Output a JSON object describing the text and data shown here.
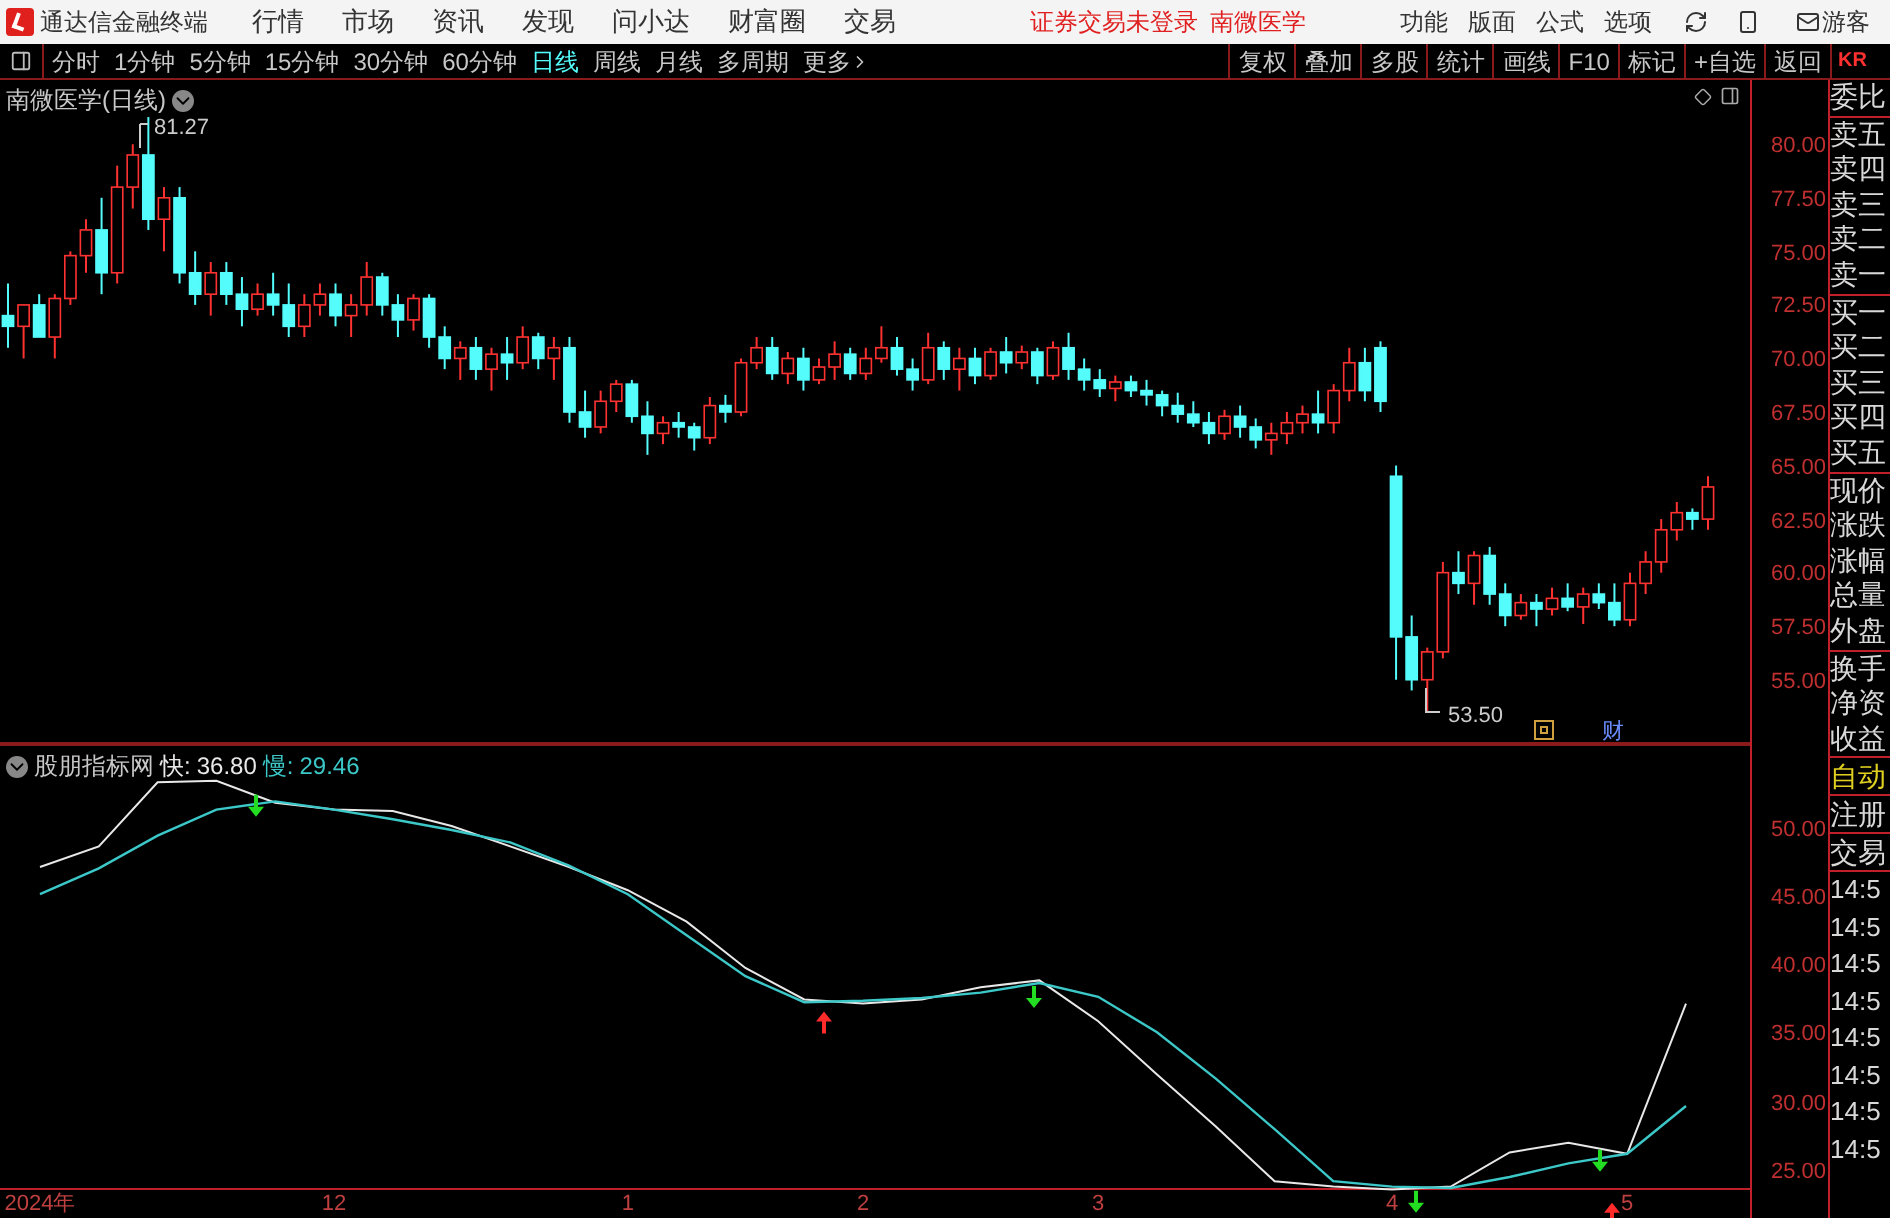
{
  "app": {
    "title": "通达信金融终端"
  },
  "menu": [
    "行情",
    "市场",
    "资讯",
    "发现",
    "问小达",
    "财富圈",
    "交易"
  ],
  "login_notice": "证券交易未登录",
  "stock_link": "南微医学",
  "menu_right": [
    "功能",
    "版面",
    "公式",
    "选项"
  ],
  "user": "游客",
  "periods": [
    {
      "label": "分时",
      "selected": false
    },
    {
      "label": "1分钟",
      "selected": false
    },
    {
      "label": "5分钟",
      "selected": false
    },
    {
      "label": "15分钟",
      "selected": false
    },
    {
      "label": "30分钟",
      "selected": false
    },
    {
      "label": "60分钟",
      "selected": false
    },
    {
      "label": "日线",
      "selected": true
    },
    {
      "label": "周线",
      "selected": false
    },
    {
      "label": "月线",
      "selected": false
    },
    {
      "label": "多周期",
      "selected": false
    },
    {
      "label": "更多",
      "selected": false
    }
  ],
  "tools": [
    "复权",
    "叠加",
    "多股",
    "统计",
    "画线",
    "F10",
    "标记",
    "+自选",
    "返回"
  ],
  "quote_tag": "KR",
  "price_chart": {
    "title": "南微医学(日线)",
    "high_label": "81.27",
    "low_label": "53.50",
    "finance_marker": "财",
    "chart_data": {
      "type": "candlestick",
      "ylim": [
        52,
        83
      ],
      "categories": [
        null,
        null,
        null,
        null,
        null,
        null,
        null,
        null,
        null,
        null,
        null,
        null,
        null,
        null,
        null,
        null,
        null,
        null,
        null,
        null,
        null,
        null,
        null,
        null,
        null,
        null,
        null,
        null,
        null,
        null,
        null,
        null,
        null,
        null,
        null,
        null,
        null,
        null,
        null,
        null,
        null,
        null,
        null,
        null,
        null,
        null,
        null,
        null,
        null,
        null,
        null,
        null,
        null,
        null,
        null,
        null,
        null,
        null,
        null,
        null,
        null,
        null,
        null,
        null,
        null,
        null,
        null,
        null,
        null,
        null,
        null,
        null,
        null,
        null,
        null,
        null,
        null,
        null,
        null,
        null,
        null,
        null,
        null,
        null,
        null,
        null,
        null,
        null,
        null,
        null,
        null,
        null,
        null,
        null,
        null,
        null,
        null,
        null,
        null,
        null,
        null,
        null,
        null,
        null,
        null,
        null,
        null,
        null,
        null,
        null
      ],
      "ohlc": [
        [
          72,
          73.5,
          70.5,
          71.5
        ],
        [
          71.5,
          72.5,
          70,
          72.5
        ],
        [
          72.5,
          73,
          71,
          71
        ],
        [
          71,
          73,
          70,
          72.8
        ],
        [
          72.8,
          75,
          72.5,
          74.8
        ],
        [
          74.8,
          76.5,
          74,
          76
        ],
        [
          76,
          77.5,
          73,
          74
        ],
        [
          74,
          79,
          73.5,
          78
        ],
        [
          78,
          80,
          77,
          79.5
        ],
        [
          79.5,
          81.27,
          76,
          76.5
        ],
        [
          76.5,
          78,
          75,
          77.5
        ],
        [
          77.5,
          78,
          73.5,
          74
        ],
        [
          74,
          75,
          72.5,
          73
        ],
        [
          73,
          74.5,
          72,
          74
        ],
        [
          74,
          74.5,
          72.5,
          73
        ],
        [
          73,
          73.8,
          71.5,
          72.3
        ],
        [
          72.3,
          73.5,
          72,
          73
        ],
        [
          73,
          74,
          72,
          72.5
        ],
        [
          72.5,
          73.5,
          71,
          71.5
        ],
        [
          71.5,
          73,
          71,
          72.5
        ],
        [
          72.5,
          73.5,
          72,
          73
        ],
        [
          73,
          73.5,
          71.5,
          72
        ],
        [
          72,
          73,
          71,
          72.5
        ],
        [
          72.5,
          74.5,
          72,
          73.8
        ],
        [
          73.8,
          74,
          72,
          72.5
        ],
        [
          72.5,
          73,
          71,
          71.8
        ],
        [
          71.8,
          73,
          71.3,
          72.8
        ],
        [
          72.8,
          73,
          70.5,
          71
        ],
        [
          71,
          71.5,
          69.5,
          70
        ],
        [
          70,
          70.8,
          69,
          70.5
        ],
        [
          70.5,
          71,
          69,
          69.5
        ],
        [
          69.5,
          70.5,
          68.5,
          70.2
        ],
        [
          70.2,
          71,
          69,
          69.8
        ],
        [
          69.8,
          71.5,
          69.5,
          71
        ],
        [
          71,
          71.2,
          69.5,
          70
        ],
        [
          70,
          71,
          69,
          70.5
        ],
        [
          70.5,
          71,
          67,
          67.5
        ],
        [
          67.5,
          68.5,
          66.3,
          66.8
        ],
        [
          66.8,
          68.5,
          66.5,
          68
        ],
        [
          68,
          69,
          67.5,
          68.8
        ],
        [
          68.8,
          69,
          67,
          67.3
        ],
        [
          67.3,
          68,
          65.5,
          66.5
        ],
        [
          66.5,
          67.3,
          66,
          67
        ],
        [
          67,
          67.5,
          66.3,
          66.8
        ],
        [
          66.8,
          67,
          65.7,
          66.3
        ],
        [
          66.3,
          68.2,
          66,
          67.8
        ],
        [
          67.8,
          68.3,
          67,
          67.5
        ],
        [
          67.5,
          70,
          67.3,
          69.8
        ],
        [
          69.8,
          71,
          69.5,
          70.5
        ],
        [
          70.5,
          71,
          69,
          69.3
        ],
        [
          69.3,
          70.3,
          68.8,
          70
        ],
        [
          70,
          70.5,
          68.5,
          69
        ],
        [
          69,
          70,
          68.8,
          69.6
        ],
        [
          69.6,
          70.8,
          69,
          70.2
        ],
        [
          70.2,
          70.5,
          69,
          69.3
        ],
        [
          69.3,
          70.5,
          69,
          70
        ],
        [
          70,
          71.5,
          69.8,
          70.5
        ],
        [
          70.5,
          71,
          69.2,
          69.5
        ],
        [
          69.5,
          70,
          68.5,
          69
        ],
        [
          69,
          71.2,
          68.8,
          70.5
        ],
        [
          70.5,
          70.8,
          69,
          69.5
        ],
        [
          69.5,
          70.5,
          68.5,
          70
        ],
        [
          70,
          70.5,
          68.8,
          69.2
        ],
        [
          69.2,
          70.5,
          69,
          70.3
        ],
        [
          70.3,
          71,
          69.3,
          69.8
        ],
        [
          69.8,
          70.6,
          69.5,
          70.3
        ],
        [
          70.3,
          70.5,
          68.8,
          69.2
        ],
        [
          69.2,
          70.8,
          69,
          70.5
        ],
        [
          70.5,
          71.2,
          69,
          69.5
        ],
        [
          69.5,
          70,
          68.5,
          69
        ],
        [
          69,
          69.5,
          68.2,
          68.6
        ],
        [
          68.6,
          69.2,
          68,
          68.9
        ],
        [
          68.9,
          69.2,
          68.2,
          68.5
        ],
        [
          68.5,
          69,
          67.8,
          68.3
        ],
        [
          68.3,
          68.5,
          67.3,
          67.8
        ],
        [
          67.8,
          68.4,
          67,
          67.4
        ],
        [
          67.4,
          68,
          66.8,
          67
        ],
        [
          67,
          67.5,
          66,
          66.5
        ],
        [
          66.5,
          67.6,
          66.2,
          67.3
        ],
        [
          67.3,
          67.8,
          66.3,
          66.8
        ],
        [
          66.8,
          67.2,
          65.8,
          66.2
        ],
        [
          66.2,
          67,
          65.5,
          66.5
        ],
        [
          66.5,
          67.5,
          66,
          67
        ],
        [
          67,
          67.8,
          66.5,
          67.4
        ],
        [
          67.4,
          68.5,
          66.5,
          67
        ],
        [
          67,
          68.8,
          66.5,
          68.5
        ],
        [
          68.5,
          70.5,
          68,
          69.8
        ],
        [
          69.8,
          70.5,
          68,
          68.5
        ],
        [
          70.5,
          70.8,
          67.5,
          68
        ],
        [
          64.5,
          65,
          55,
          57
        ],
        [
          57,
          58,
          54.5,
          55
        ],
        [
          55,
          56.5,
          53.5,
          56.3
        ],
        [
          56.3,
          60.5,
          56,
          60
        ],
        [
          60,
          61,
          59,
          59.5
        ],
        [
          59.5,
          61,
          58.5,
          60.8
        ],
        [
          60.8,
          61.2,
          58.5,
          59
        ],
        [
          59,
          59.5,
          57.5,
          58
        ],
        [
          58,
          59,
          57.8,
          58.6
        ],
        [
          58.6,
          59,
          57.5,
          58.3
        ],
        [
          58.3,
          59.3,
          58,
          58.8
        ],
        [
          58.8,
          59.5,
          58.2,
          58.4
        ],
        [
          58.4,
          59.3,
          57.6,
          59
        ],
        [
          59,
          59.5,
          58.3,
          58.6
        ],
        [
          58.6,
          59.5,
          57.5,
          57.8
        ],
        [
          57.8,
          60,
          57.5,
          59.5
        ],
        [
          59.5,
          61,
          59,
          60.5
        ],
        [
          60.5,
          62.5,
          60,
          62
        ],
        [
          62,
          63.3,
          61.5,
          62.8
        ],
        [
          62.8,
          63,
          62,
          62.5
        ],
        [
          62.5,
          64.5,
          62,
          64
        ]
      ],
      "yticks": [
        {
          "value": 80,
          "label": "80.00"
        },
        {
          "value": 77.5,
          "label": "77.50"
        },
        {
          "value": 75,
          "label": "75.00"
        },
        {
          "value": 72.5,
          "label": "72.50"
        },
        {
          "value": 70,
          "label": "70.00"
        },
        {
          "value": 67.5,
          "label": "67.50"
        },
        {
          "value": 65,
          "label": "65.00"
        },
        {
          "value": 62.5,
          "label": "62.50"
        },
        {
          "value": 60,
          "label": "60.00"
        },
        {
          "value": 57.5,
          "label": "57.50"
        },
        {
          "value": 55,
          "label": "55.00"
        }
      ]
    }
  },
  "indicator": {
    "name": "股朋指标网",
    "fast_value": "36.80",
    "slow_value": "29.46",
    "chart_data": {
      "type": "line",
      "ylim": [
        21.3,
        56
      ],
      "categories": [
        "2024年",
        null,
        null,
        null,
        null,
        "12",
        null,
        null,
        null,
        null,
        "1",
        null,
        null,
        null,
        "2",
        null,
        null,
        null,
        "3",
        null,
        null,
        null,
        null,
        "4",
        null,
        null,
        null,
        "5",
        null
      ],
      "yticks": [
        {
          "value": 50,
          "label": "50.00"
        },
        {
          "value": 45,
          "label": "45.00"
        },
        {
          "value": 40,
          "label": "40.00"
        },
        {
          "value": 35,
          "label": "35.00"
        },
        {
          "value": 30,
          "label": "30.00"
        },
        {
          "value": 25,
          "label": "25.00"
        }
      ],
      "series": [
        {
          "name": "快:",
          "color": "#e8e8e8",
          "values": [
            47,
            48.5,
            53.2,
            53.3,
            51.7,
            51.2,
            51.1,
            50,
            48.5,
            47,
            45.3,
            43,
            39.6,
            37.3,
            37,
            37.3,
            38.2,
            38.7,
            35.7,
            31.8,
            28,
            24,
            23.6,
            23.4,
            23.6,
            26.1,
            26.8,
            26,
            37
          ]
        },
        {
          "name": "慢:",
          "color": "#3cc8c8",
          "values": [
            45,
            46.9,
            49.3,
            51.2,
            51.8,
            51.2,
            50.5,
            49.7,
            48.8,
            47.1,
            45,
            42,
            39,
            37.1,
            37.2,
            37.4,
            37.8,
            38.5,
            37.5,
            34.9,
            31.5,
            27.8,
            24,
            23.6,
            23.5,
            24.3,
            25.3,
            26,
            29.5
          ]
        }
      ]
    }
  },
  "quote_panel": {
    "groups": [
      [
        "委比"
      ],
      [
        "卖五",
        "卖四",
        "卖三",
        "卖二",
        "卖一"
      ],
      [
        "买一",
        "买二",
        "买三",
        "买四",
        "买五"
      ],
      [
        "现价",
        "涨跌",
        "涨幅",
        "总量",
        "外盘"
      ],
      [
        "换手",
        "净资",
        "收益"
      ]
    ]
  },
  "status": [
    {
      "label": "自动",
      "kind": "highlight"
    },
    {
      "label": "注册",
      "kind": "plain"
    },
    {
      "label": "交易",
      "kind": "plain"
    }
  ],
  "ticks": [
    "14:5",
    "14:5",
    "14:5",
    "14:5",
    "14:5",
    "14:5",
    "14:5",
    "14:5"
  ]
}
